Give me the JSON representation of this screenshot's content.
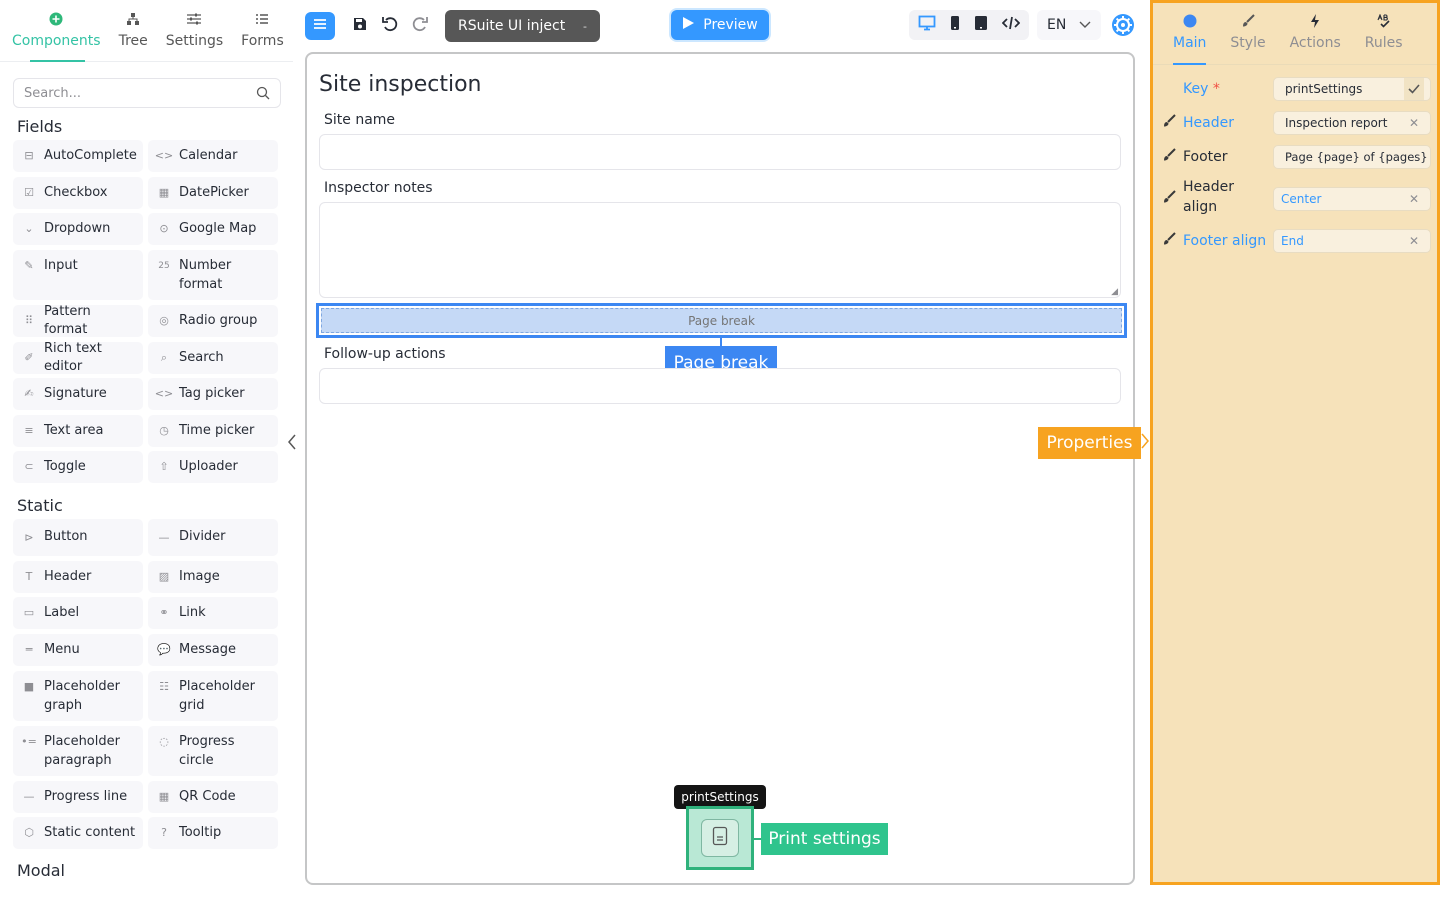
{
  "left_panel": {
    "tabs": [
      {
        "label": "Components",
        "icon": "plus-circle-icon",
        "active": true
      },
      {
        "label": "Tree",
        "icon": "tree-icon"
      },
      {
        "label": "Settings",
        "icon": "sliders-icon"
      },
      {
        "label": "Forms",
        "icon": "list-icon"
      }
    ],
    "search_placeholder": "Search...",
    "groups": {
      "fields": "Fields",
      "static": "Static",
      "modal": "Modal"
    },
    "fields": [
      "AutoComplete",
      "Calendar",
      "Checkbox",
      "DatePicker",
      "Dropdown",
      "Google Map",
      "Input",
      "Number format",
      "Pattern format",
      "Radio group",
      "Rich text editor",
      "Search",
      "Signature",
      "Tag picker",
      "Text area",
      "Time picker",
      "Toggle",
      "Uploader"
    ],
    "static": [
      "Button",
      "Divider",
      "Header",
      "Image",
      "Label",
      "Link",
      "Menu",
      "Message",
      "Placeholder graph",
      "Placeholder grid",
      "Placeholder paragraph",
      "Progress circle",
      "Progress line",
      "QR Code",
      "Static content",
      "Tooltip"
    ]
  },
  "toolbar": {
    "project_name": "RSuite UI inject",
    "project_caret": "-",
    "preview_label": "Preview",
    "language": "EN"
  },
  "canvas": {
    "title": "Site inspection",
    "site_name_label": "Site name",
    "inspector_notes_label": "Inspector notes",
    "page_break_text": "Page break",
    "page_break_tag": "Page break",
    "followup_label": "Follow-up actions",
    "properties_tag": "Properties",
    "print_tooltip": "printSettings",
    "print_tag": "Print settings"
  },
  "right_panel": {
    "tabs": [
      {
        "label": "Main",
        "active": true
      },
      {
        "label": "Style"
      },
      {
        "label": "Actions"
      },
      {
        "label": "Rules"
      }
    ],
    "props": {
      "key_label": "Key",
      "key_required": "*",
      "key_value": "printSettings",
      "header_label": "Header",
      "header_value": "Inspection report",
      "footer_label": "Footer",
      "footer_value": "Page {page} of {pages}",
      "header_align_label": "Header align",
      "header_align_value": "Center",
      "footer_align_label": "Footer align",
      "footer_align_value": "End"
    }
  },
  "colors": {
    "accent": "#3498ff",
    "green": "#2fc48d",
    "orange": "#f7a320"
  }
}
